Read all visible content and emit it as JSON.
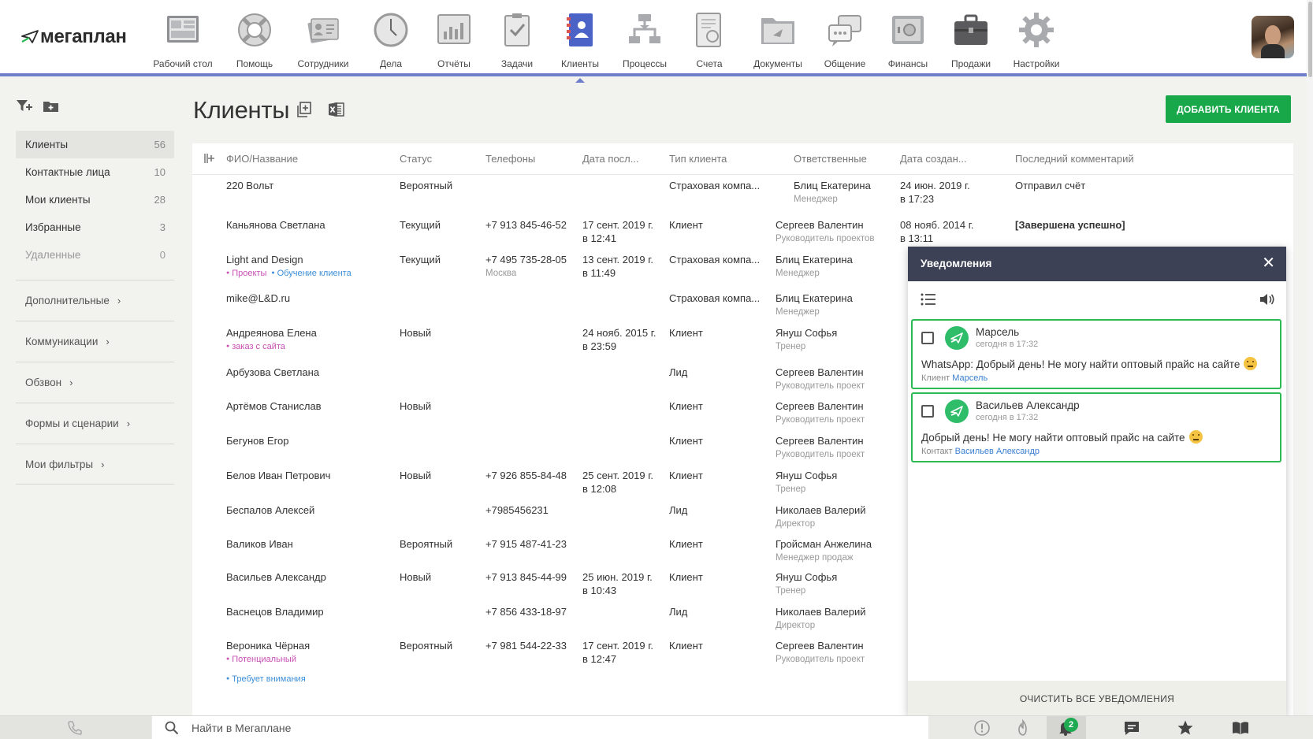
{
  "app": {
    "logo_text": "мегаплан"
  },
  "nav": [
    {
      "label": "Рабочий стол",
      "icon": "desktop-icon"
    },
    {
      "label": "Помощь",
      "icon": "lifebuoy-icon"
    },
    {
      "label": "Сотрудники",
      "icon": "employees-icon"
    },
    {
      "label": "Дела",
      "icon": "clock-icon"
    },
    {
      "label": "Отчёты",
      "icon": "reports-icon"
    },
    {
      "label": "Задачи",
      "icon": "tasks-icon"
    },
    {
      "label": "Клиенты",
      "icon": "clients-icon",
      "active": true
    },
    {
      "label": "Процессы",
      "icon": "processes-icon"
    },
    {
      "label": "Счета",
      "icon": "invoices-icon"
    },
    {
      "label": "Документы",
      "icon": "documents-icon"
    },
    {
      "label": "Общение",
      "icon": "chat-icon"
    },
    {
      "label": "Финансы",
      "icon": "safe-icon"
    },
    {
      "label": "Продажи",
      "icon": "briefcase-icon"
    },
    {
      "label": "Настройки",
      "icon": "gear-icon"
    }
  ],
  "sidebar": {
    "items": [
      {
        "label": "Клиенты",
        "count": "56",
        "active": true
      },
      {
        "label": "Контактные лица",
        "count": "10"
      },
      {
        "label": "Мои клиенты",
        "count": "28"
      },
      {
        "label": "Избранные",
        "count": "3"
      },
      {
        "label": "Удаленные",
        "count": "0",
        "muted": true
      }
    ],
    "sections": [
      {
        "label": "Дополнительные"
      },
      {
        "label": "Коммуникации"
      },
      {
        "label": "Обзвон"
      },
      {
        "label": "Формы и сценарии"
      },
      {
        "label": "Мои фильтры"
      }
    ]
  },
  "page": {
    "title": "Клиенты",
    "add_button": "ДОБАВИТЬ КЛИЕНТА"
  },
  "table": {
    "columns": [
      "ФИО/Название",
      "Статус",
      "Телефоны",
      "Дата посл...",
      "Тип клиента",
      "Ответственные",
      "Дата создан...",
      "Последний комментарий"
    ],
    "rows": [
      {
        "name": "220 Вольт",
        "status": "Вероятный",
        "phone": "",
        "phone_sub": "",
        "last_date": "",
        "last_time": "",
        "type": "Страховая компа...",
        "resp": "Блиц Екатерина",
        "resp_role": "Менеджер",
        "resp_expand": true,
        "created": "24 июн. 2019 г.",
        "created_time": "в 17:23",
        "comment": "Отправил счёт",
        "comment_bold": false,
        "tags": [],
        "h": 43
      },
      {
        "name": "Каньянова Светлана",
        "status": "Текущий",
        "phone": "+7 913 845-46-52",
        "phone_sub": "",
        "last_date": "17 сент. 2019 г.",
        "last_time": "в 12:41",
        "type": "Клиент",
        "resp": "Сергеев Валентин",
        "resp_role": "Руководитель проектов",
        "created": "08 нояб. 2014 г.",
        "created_time": "в 13:11",
        "comment": "[Завершена успешно]",
        "comment_bold": true,
        "tags": [],
        "h": 44
      },
      {
        "name": "Light and Design",
        "status": "Текущий",
        "phone": "+7 495 735-28-05",
        "phone_sub": "Москва",
        "last_date": "13 сент. 2019 г.",
        "last_time": "в 11:49",
        "type": "Страховая компа...",
        "resp": "Блиц Екатерина",
        "resp_role": "Менеджер",
        "created": "",
        "created_time": "",
        "comment": "",
        "tags": [
          {
            "text": "Проекты",
            "color": "pink"
          },
          {
            "text": "Обучение клиента",
            "color": "blue"
          }
        ],
        "h": 49
      },
      {
        "name": "mike@L&D.ru",
        "status": "",
        "phone": "",
        "phone_sub": "",
        "last_date": "",
        "last_time": "",
        "type": "Страховая компа...",
        "resp": "Блиц Екатерина",
        "resp_role": "Менеджер",
        "created": "",
        "created_time": "",
        "comment": "",
        "tags": [],
        "h": 44
      },
      {
        "name": "Андреянова Елена",
        "status": "Новый",
        "phone": "",
        "phone_sub": "",
        "last_date": "24 нояб. 2015 г.",
        "last_time": "в 23:59",
        "type": "Клиент",
        "resp": "Януш Софья",
        "resp_role": "Тренер",
        "created": "",
        "created_time": "",
        "comment": "",
        "tags": [
          {
            "text": "заказ с сайта",
            "color": "pink"
          }
        ],
        "h": 50
      },
      {
        "name": "Арбузова Светлана",
        "status": "",
        "phone": "",
        "phone_sub": "",
        "last_date": "",
        "last_time": "",
        "type": "Лид",
        "resp": "Сергеев Валентин",
        "resp_role": "Руководитель проект",
        "created": "",
        "created_time": "",
        "comment": "",
        "tags": [],
        "h": 43
      },
      {
        "name": "Артёмов Станислав",
        "status": "Новый",
        "phone": "",
        "phone_sub": "",
        "last_date": "",
        "last_time": "",
        "type": "Клиент",
        "resp": "Сергеев Валентин",
        "resp_role": "Руководитель проект",
        "created": "",
        "created_time": "",
        "comment": "",
        "tags": [],
        "h": 44
      },
      {
        "name": "Бегунов Егор",
        "status": "",
        "phone": "",
        "phone_sub": "",
        "last_date": "",
        "last_time": "",
        "type": "Клиент",
        "resp": "Сергеев Валентин",
        "resp_role": "Руководитель проект",
        "created": "",
        "created_time": "",
        "comment": "",
        "tags": [],
        "h": 44
      },
      {
        "name": "Белов Иван Петрович",
        "status": "Новый",
        "phone": "+7 926 855-84-48",
        "phone_sub": "",
        "last_date": "25 сент. 2019 г.",
        "last_time": "в 12:08",
        "type": "Клиент",
        "resp": "Януш Софья",
        "resp_role": "Тренер",
        "created": "",
        "created_time": "",
        "comment": "",
        "tags": [],
        "h": 44
      },
      {
        "name": "Беспалов Алексей",
        "status": "",
        "phone": "+7985456231",
        "phone_sub": "",
        "last_date": "",
        "last_time": "",
        "type": "Лид",
        "resp": "Николаев Валерий",
        "resp_role": "Директор",
        "created": "",
        "created_time": "",
        "comment": "",
        "tags": [],
        "h": 43
      },
      {
        "name": "Валиков Иван",
        "status": "Вероятный",
        "phone": "+7 915 487-41-23",
        "phone_sub": "",
        "last_date": "",
        "last_time": "",
        "type": "Клиент",
        "resp": "Гройсман Анжелина",
        "resp_role": "Менеджер продаж",
        "created": "",
        "created_time": "",
        "comment": "",
        "tags": [],
        "h": 42
      },
      {
        "name": "Васильев Александр",
        "status": "Новый",
        "phone": "+7 913 845-44-99",
        "phone_sub": "",
        "last_date": "25 июн. 2019 г.",
        "last_time": "в 10:43",
        "type": "Клиент",
        "resp": "Януш Софья",
        "resp_role": "Тренер",
        "created": "",
        "created_time": "",
        "comment": "",
        "tags": [],
        "h": 44
      },
      {
        "name": "Васнецов Владимир",
        "status": "",
        "phone": "+7 856 433-18-97",
        "phone_sub": "",
        "last_date": "",
        "last_time": "",
        "type": "Лид",
        "resp": "Николаев Валерий",
        "resp_role": "Директор",
        "created": "",
        "created_time": "",
        "comment": "",
        "tags": [],
        "h": 43
      },
      {
        "name": "Вероника Чёрная",
        "status": "Вероятный",
        "phone": "+7 981 544-22-33",
        "phone_sub": "",
        "last_date": "17 сент. 2019 г.",
        "last_time": "в 12:47",
        "type": "Клиент",
        "resp": "Сергеев Валентин",
        "resp_role": "Руководитель проект",
        "created": "",
        "created_time": "",
        "comment": "",
        "tags": [
          {
            "text": "Потенциальный",
            "color": "pink"
          }
        ],
        "tags2": [
          {
            "text": "Требует внимания",
            "color": "blue"
          }
        ],
        "h": 60
      }
    ]
  },
  "notifications": {
    "title": "Уведомления",
    "clear_button": "ОЧИСТИТЬ ВСЕ УВЕДОМЛЕНИЯ",
    "items": [
      {
        "name": "Марсель",
        "time": "сегодня в 17:32",
        "message": "WhatsApp: Добрый день! Не могу найти оптовый прайс на сайте",
        "ref_label": "Клиент",
        "ref_link": "Марсель"
      },
      {
        "name": "Васильев Александр",
        "time": "сегодня в 17:32",
        "message": "Добрый день! Не могу найти оптовый прайс на сайте",
        "ref_label": "Контакт",
        "ref_link": "Васильев Александр"
      }
    ]
  },
  "bottombar": {
    "search_placeholder": "Найти в Мегаплане",
    "badge_count": "2"
  },
  "colors": {
    "accent": "#6f7ecb",
    "green": "#18a84a",
    "notif_header": "#3d4156"
  }
}
